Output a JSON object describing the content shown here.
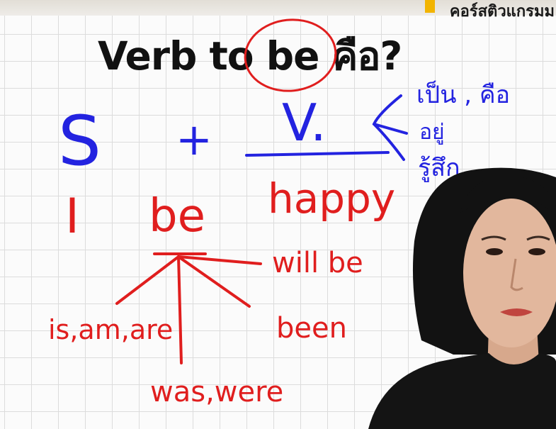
{
  "brand": {
    "text": "คอร์สติวแกรมม"
  },
  "title": {
    "text": "Verb to be คือ?"
  },
  "formula": {
    "subject": "S",
    "plus": "+",
    "verb": "V.",
    "meanings": [
      "เป็น , คือ",
      "อยู่",
      "รู้สึก"
    ]
  },
  "example": {
    "subject": "I",
    "verb": "be",
    "complement": "happy"
  },
  "forms": {
    "present": "is,am,are",
    "past": "was,were",
    "future": "will be",
    "perfect": "been"
  },
  "colors": {
    "ink_blue": "#2323e0",
    "ink_red": "#e01e1e",
    "title": "#111111",
    "accent": "#f2b400"
  }
}
